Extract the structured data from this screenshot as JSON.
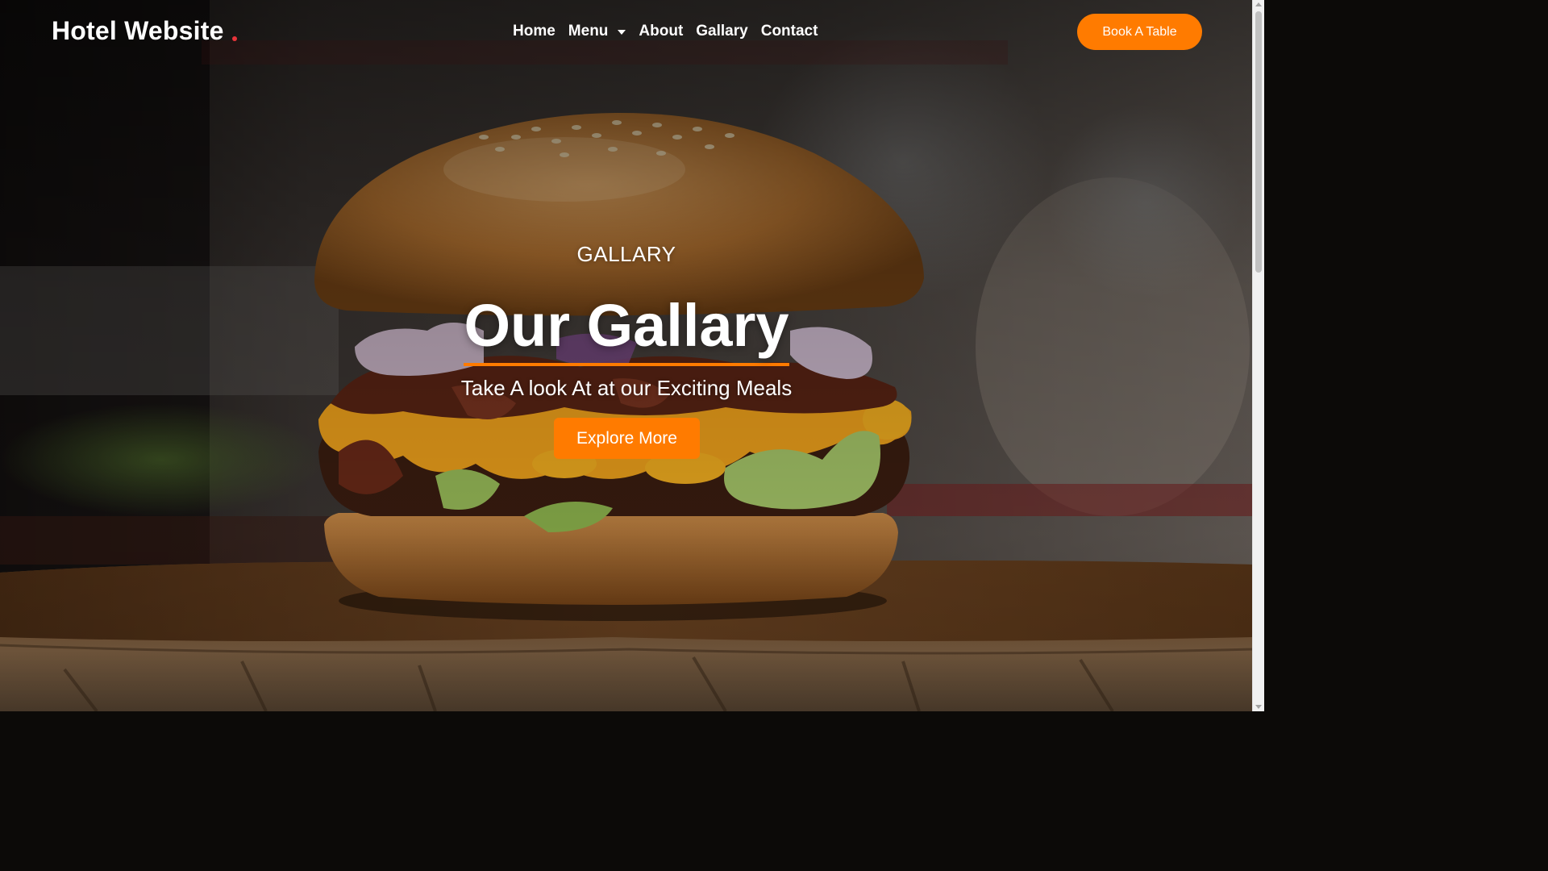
{
  "colors": {
    "accent": "#ff7b00",
    "brand_dot": "#e8343a",
    "text": "#ffffff"
  },
  "navbar": {
    "brand": "Hotel Website",
    "links": [
      {
        "label": "Home"
      },
      {
        "label": "Menu",
        "has_dropdown": true
      },
      {
        "label": "About"
      },
      {
        "label": "Gallary"
      },
      {
        "label": "Contact"
      }
    ],
    "cta_label": "Book A Table"
  },
  "hero": {
    "eyebrow": "GALLARY",
    "headline": "Our Gallary",
    "subheadline": "Take A look At at our Exciting Meals",
    "button_label": "Explore More",
    "background_image": "burger-photo"
  }
}
